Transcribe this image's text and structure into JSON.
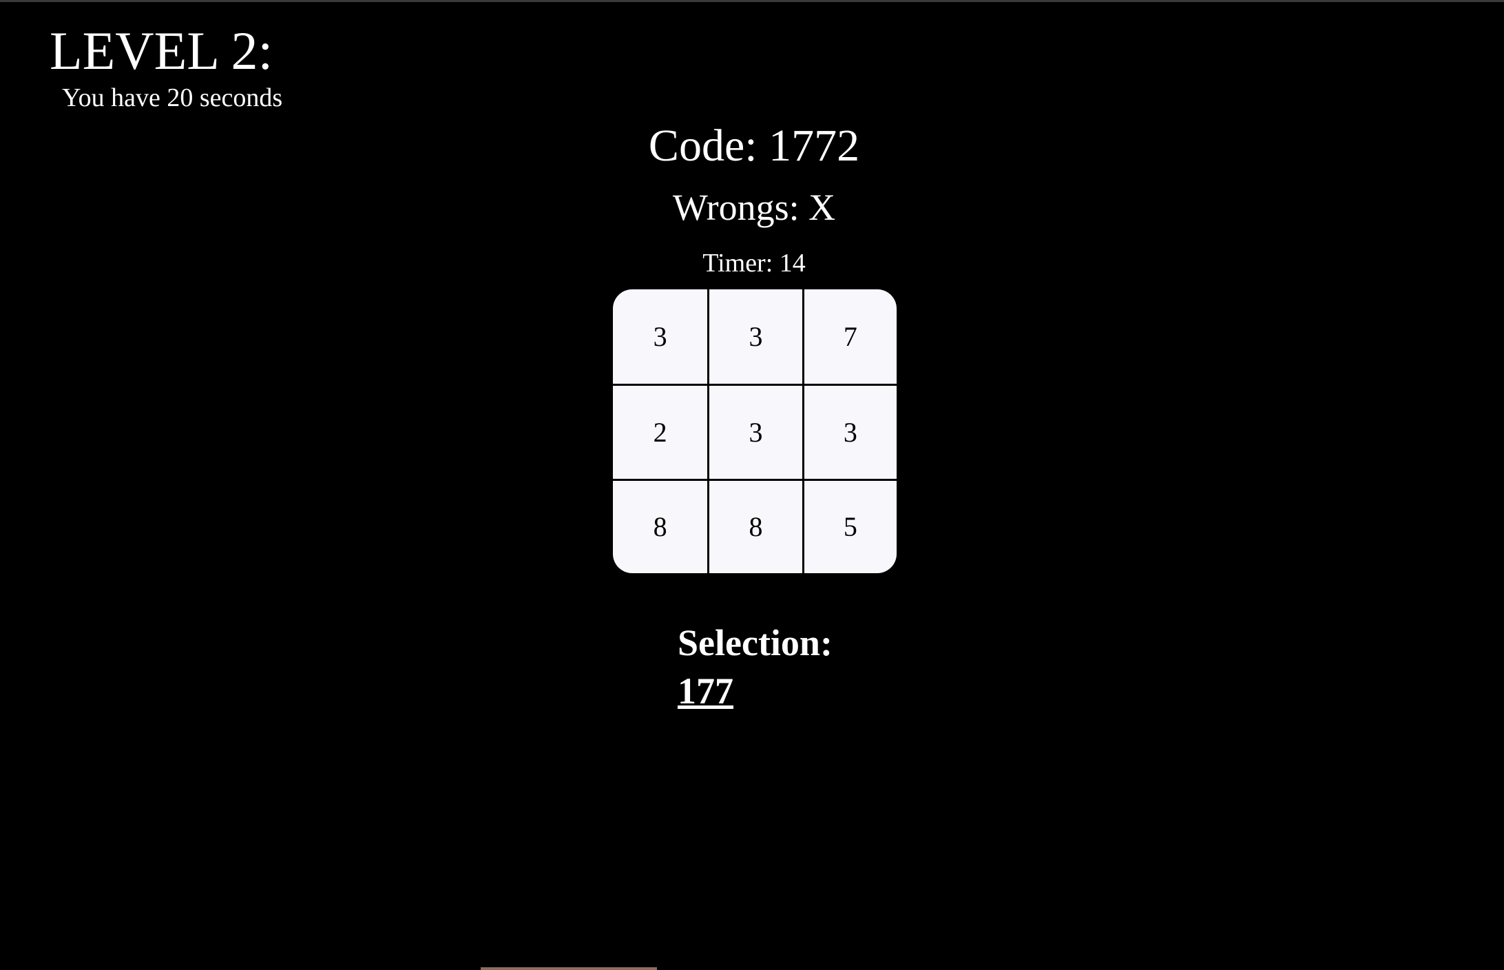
{
  "level": {
    "title": "LEVEL 2:",
    "subtitle": "You have 20 seconds"
  },
  "status": {
    "code": "Code: 1772",
    "wrongs": "Wrongs: X",
    "timer": "Timer: 14"
  },
  "keypad": {
    "keys": [
      "3",
      "3",
      "7",
      "2",
      "3",
      "3",
      "8",
      "8",
      "5"
    ]
  },
  "selection": {
    "label": "Selection:",
    "value": "177"
  },
  "colors": {
    "background": "#000000",
    "text": "#ffffff",
    "keypad_background": "#f8f7fc",
    "keypad_text": "#000000"
  }
}
